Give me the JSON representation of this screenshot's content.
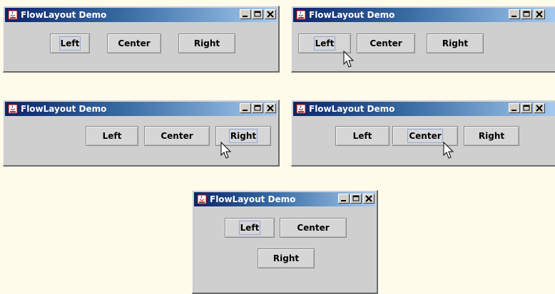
{
  "windows": [
    {
      "title": "FlowLayout Demo",
      "buttons": [
        {
          "label": "Left",
          "focused": true
        },
        {
          "label": "Center",
          "focused": false
        },
        {
          "label": "Right",
          "focused": false
        }
      ]
    },
    {
      "title": "FlowLayout Demo",
      "buttons": [
        {
          "label": "Left",
          "focused": true
        },
        {
          "label": "Center",
          "focused": false
        },
        {
          "label": "Right",
          "focused": false
        }
      ]
    },
    {
      "title": "FlowLayout Demo",
      "buttons": [
        {
          "label": "Left",
          "focused": false
        },
        {
          "label": "Center",
          "focused": false
        },
        {
          "label": "Right",
          "focused": true
        }
      ]
    },
    {
      "title": "FlowLayout Demo",
      "buttons": [
        {
          "label": "Left",
          "focused": false
        },
        {
          "label": "Center",
          "focused": true
        },
        {
          "label": "Right",
          "focused": false
        }
      ]
    },
    {
      "title": "FlowLayout Demo",
      "buttons": [
        {
          "label": "Left",
          "focused": true
        },
        {
          "label": "Center",
          "focused": false
        },
        {
          "label": "Right",
          "focused": false
        }
      ]
    }
  ]
}
